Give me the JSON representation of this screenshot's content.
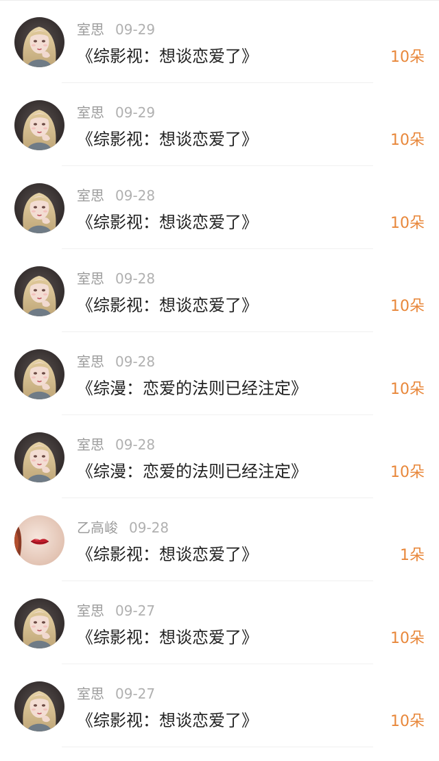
{
  "colors": {
    "accent": "#e8873a",
    "name": "#9c9c9c",
    "title": "#222222"
  },
  "rows": [
    {
      "name": "室思",
      "date": "09-29",
      "title": "《综影视：想谈恋爱了》",
      "gift": "10朵",
      "avatar": "avatar-girl-icon"
    },
    {
      "name": "室思",
      "date": "09-29",
      "title": "《综影视：想谈恋爱了》",
      "gift": "10朵",
      "avatar": "avatar-girl-icon"
    },
    {
      "name": "室思",
      "date": "09-28",
      "title": "《综影视：想谈恋爱了》",
      "gift": "10朵",
      "avatar": "avatar-girl-icon"
    },
    {
      "name": "室思",
      "date": "09-28",
      "title": "《综影视：想谈恋爱了》",
      "gift": "10朵",
      "avatar": "avatar-girl-icon"
    },
    {
      "name": "室思",
      "date": "09-28",
      "title": "《综漫：恋爱的法则已经注定》",
      "gift": "10朵",
      "avatar": "avatar-girl-icon"
    },
    {
      "name": "室思",
      "date": "09-28",
      "title": "《综漫：恋爱的法则已经注定》",
      "gift": "10朵",
      "avatar": "avatar-girl-icon"
    },
    {
      "name": "乙高峻",
      "date": "09-28",
      "title": "《综影视：想谈恋爱了》",
      "gift": "1朵",
      "avatar": "avatar-lips-icon"
    },
    {
      "name": "室思",
      "date": "09-27",
      "title": "《综影视：想谈恋爱了》",
      "gift": "10朵",
      "avatar": "avatar-girl-icon"
    },
    {
      "name": "室思",
      "date": "09-27",
      "title": "《综影视：想谈恋爱了》",
      "gift": "10朵",
      "avatar": "avatar-girl-icon"
    }
  ]
}
